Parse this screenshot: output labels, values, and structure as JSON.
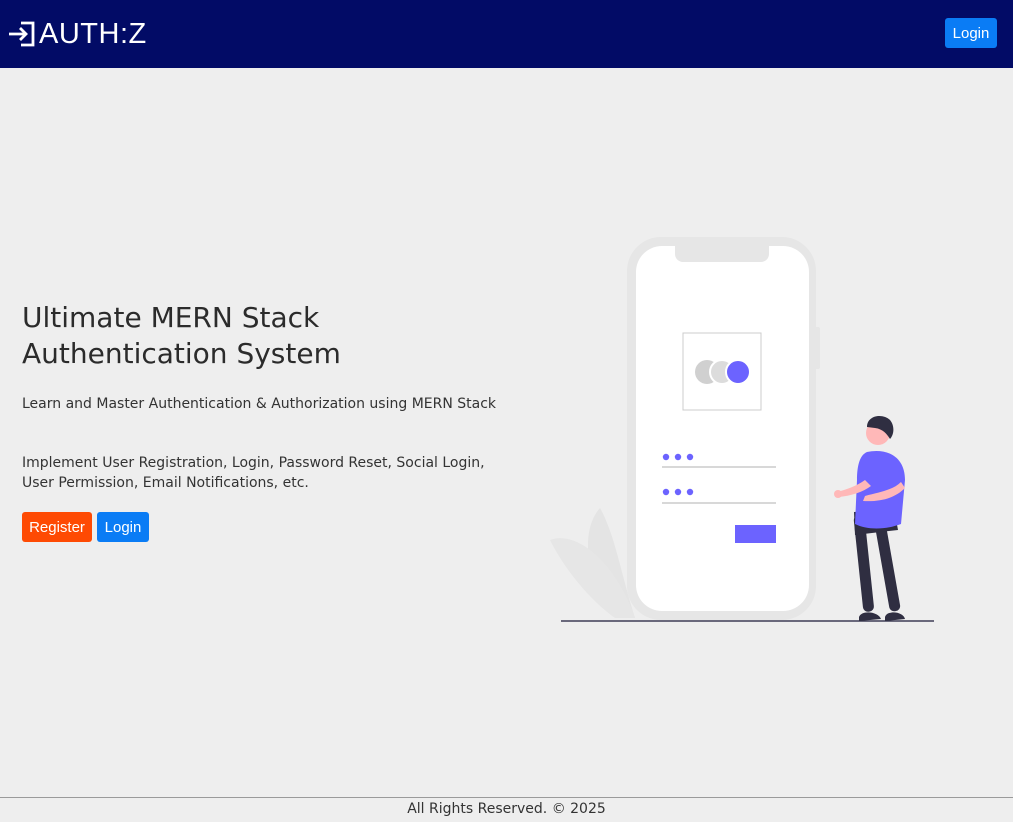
{
  "header": {
    "logo_text": "AUTH:Z",
    "logo_icon": "login-arrow-icon",
    "login_label": "Login"
  },
  "hero": {
    "title_line1": "Ultimate MERN Stack",
    "title_line2": "Authentication System",
    "paragraph1": "Learn and Master Authentication & Authorization using MERN Stack",
    "paragraph2": "Implement User Registration, Login, Password Reset, Social Login, User Permission, Email Notifications, etc.",
    "register_label": "Register",
    "login_label": "Login"
  },
  "footer": {
    "text": "All Rights Reserved. © 2025"
  },
  "colors": {
    "header_bg": "#020b66",
    "primary_button": "#0a7cf5",
    "register_button": "#fe4a03",
    "page_bg": "#eeeeee",
    "illustration_accent": "#6c63ff"
  }
}
